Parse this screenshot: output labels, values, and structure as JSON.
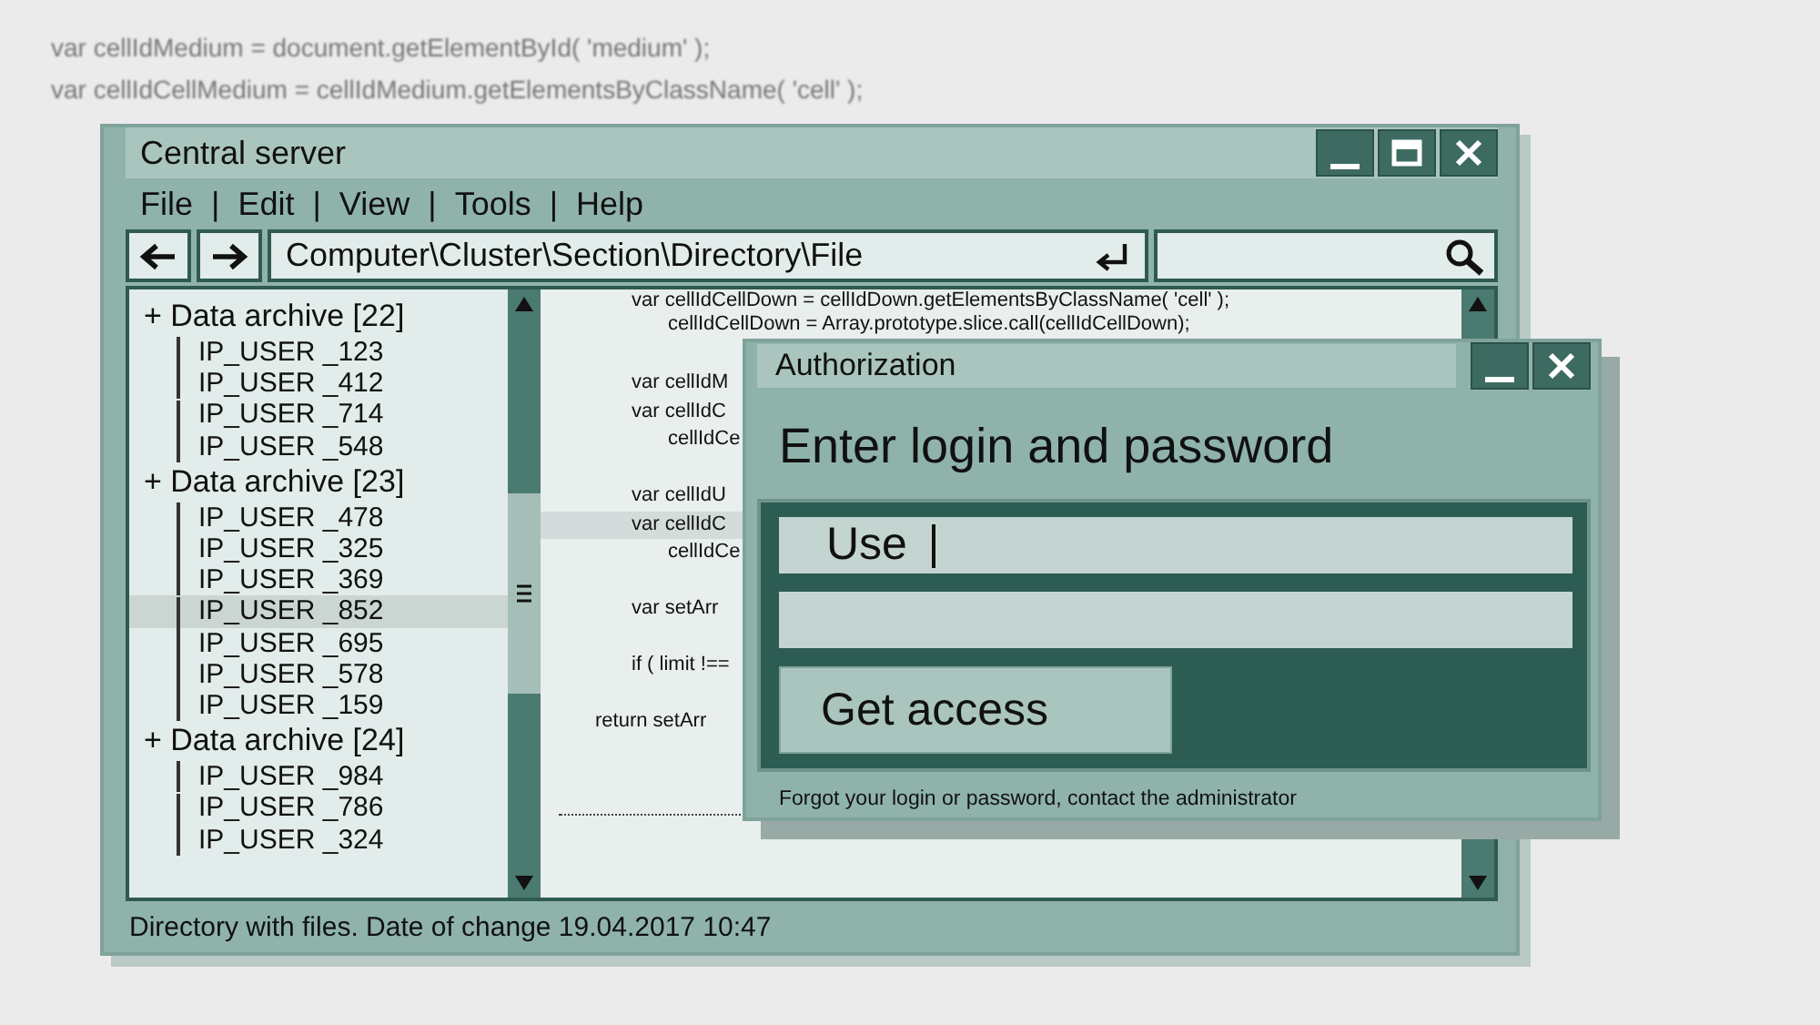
{
  "background_code": [
    "var cellIdMedium = document.getElementById( 'medium' );",
    "var cellIdCellMedium = cellIdMedium.getElementsByClassName( 'cell' );"
  ],
  "window": {
    "title": "Central server"
  },
  "menu": [
    {
      "label": "File"
    },
    {
      "label": "|"
    },
    {
      "label": "Edit"
    },
    {
      "label": "|"
    },
    {
      "label": "View"
    },
    {
      "label": "|"
    },
    {
      "label": "Tools"
    },
    {
      "label": "|"
    },
    {
      "label": "Help"
    }
  ],
  "address_bar": {
    "value": "Computer\\Cluster\\Section\\Directory\\File"
  },
  "tree": [
    {
      "label": "+ Data archive [22]",
      "children": [
        {
          "label": "IP_USER _123",
          "selected": false
        },
        {
          "label": "IP_USER _412",
          "selected": false
        },
        {
          "label": "IP_USER _714",
          "selected": false
        },
        {
          "label": "IP_USER _548",
          "selected": false
        }
      ]
    },
    {
      "label": "+ Data archive [23]",
      "children": [
        {
          "label": "IP_USER _478",
          "selected": false
        },
        {
          "label": "IP_USER _325",
          "selected": false
        },
        {
          "label": "IP_USER _369",
          "selected": false
        },
        {
          "label": "IP_USER _852",
          "selected": true
        },
        {
          "label": "IP_USER _695",
          "selected": false
        },
        {
          "label": "IP_USER _578",
          "selected": false
        },
        {
          "label": "IP_USER _159",
          "selected": false
        }
      ]
    },
    {
      "label": "+ Data archive [24]",
      "children": [
        {
          "label": "IP_USER _984",
          "selected": false
        },
        {
          "label": "IP_USER _786",
          "selected": false
        },
        {
          "label": "IP_USER _324",
          "selected": false
        }
      ]
    }
  ],
  "code": {
    "blocks": [
      {
        "lines": [
          {
            "text": "var cellIdCellDown = cellIdDown.getElementsByClassName( 'cell' );",
            "selected": false,
            "children": [
              {
                "text": "cellIdCellDown = Array.prototype.slice.call(cellIdCellDown);",
                "selected": false
              }
            ]
          }
        ]
      },
      {
        "lines": [
          {
            "text": "var cellIdM",
            "selected": false
          },
          {
            "text": "var cellIdC",
            "selected": false,
            "children": [
              {
                "text": "cellIdCe",
                "selected": false
              }
            ]
          }
        ]
      },
      {
        "lines": [
          {
            "text": "var cellIdU",
            "selected": false
          },
          {
            "text": "var cellIdC",
            "selected": true,
            "children": [
              {
                "text": "cellIdCe",
                "selected": false
              }
            ]
          }
        ]
      },
      {
        "lines": [
          {
            "text": "var setArr",
            "selected": false
          }
        ]
      },
      {
        "lines": [
          {
            "text": "if ( limit !==",
            "selected": false
          }
        ]
      }
    ],
    "return_line": "return setArr"
  },
  "status_bar": "Directory with files. Date of change 19.04.2017  10:47",
  "dialog": {
    "title": "Authorization",
    "heading": "Enter login and password",
    "login": {
      "value": "Use"
    },
    "button": "Get access",
    "note": "Forgot your login or password, contact the administrator"
  }
}
